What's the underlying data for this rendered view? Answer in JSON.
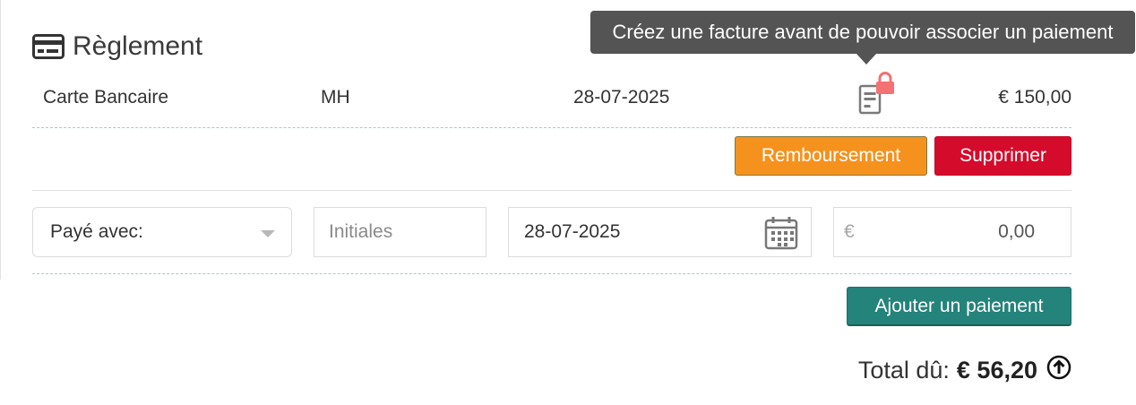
{
  "section": {
    "icon": "credit-card-icon",
    "title": "Règlement"
  },
  "tooltip": {
    "text": "Créez une facture avant de pouvoir associer un paiement"
  },
  "payment": {
    "method": "Carte Bancaire",
    "initials": "MH",
    "date": "28-07-2025",
    "invoice_icon": "invoice-icon",
    "lock_icon": "lock-icon",
    "amount": "€ 150,00"
  },
  "actions": {
    "refund_label": "Remboursement",
    "delete_label": "Supprimer"
  },
  "form": {
    "payment_method_label": "Payé avec:",
    "initials_placeholder": "Initiales",
    "date_value": "28-07-2025",
    "calendar_icon": "calendar-icon",
    "currency_symbol": "€",
    "amount_value": "0,00",
    "add_payment_label": "Ajouter un paiement"
  },
  "total": {
    "label": "Total dû:",
    "value": "€ 56,20",
    "icon": "arrow-up-circle-icon"
  },
  "colors": {
    "refund": "#f5921e",
    "delete": "#d50b2c",
    "add_payment": "#24837a",
    "tooltip": "#545454",
    "lock": "#f47174",
    "dashed_line": "#9bd0c8"
  }
}
